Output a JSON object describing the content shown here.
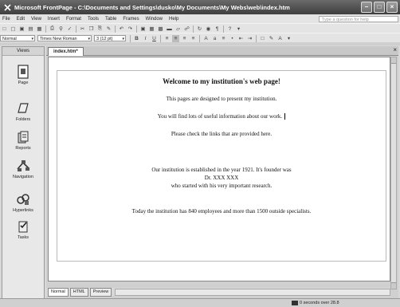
{
  "window": {
    "title": "Microsoft FrontPage - C:\\Documents and Settings\\dusko\\My Documents\\My Webs\\web\\index.htm"
  },
  "menu": [
    "File",
    "Edit",
    "View",
    "Insert",
    "Format",
    "Tools",
    "Table",
    "Frames",
    "Window",
    "Help"
  ],
  "help_placeholder": "Type a question for help",
  "format_toolbar": {
    "style": "Normal",
    "font": "Times New Roman",
    "size": "3 (12 pt)"
  },
  "views_panel": {
    "header": "Views",
    "items": [
      "Page",
      "Folders",
      "Reports",
      "Navigation",
      "Hyperlinks",
      "Tasks"
    ]
  },
  "document_tab": "index.htm*",
  "page_content": {
    "heading": "Welcome to my institution's web page!",
    "line1": "This pages are designed to present my institution.",
    "line2": "You will find lots of useful information about our work.",
    "line3": "Please check the links that are provided here.",
    "line4": "Our institution is established in the year 1921. It's founder was",
    "line5": "Dr. XXX XXX",
    "line6": "who started with his very important research.",
    "line7": "Today the institution has 840 employees and more than 1500 outside specialists."
  },
  "view_tabs": [
    "Normal",
    "HTML",
    "Preview"
  ],
  "status": {
    "download_time": "0 seconds over 28.8"
  }
}
